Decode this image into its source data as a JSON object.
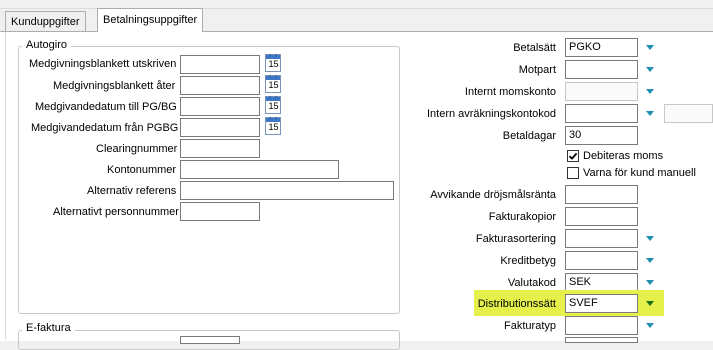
{
  "tabs": [
    {
      "label": "Kunduppgifter",
      "active": false
    },
    {
      "label": "Betalningsuppgifter",
      "active": true
    }
  ],
  "autogiro": {
    "legend": "Autogiro",
    "rows": [
      {
        "label": "Medgivningsblankett utskriven",
        "value": "",
        "calendar": true
      },
      {
        "label": "Medgivningsblankett åter",
        "value": "",
        "calendar": true
      },
      {
        "label": "Medgivandedatum till PG/BG",
        "value": "",
        "calendar": true
      },
      {
        "label": "Medgivandedatum från PGBG",
        "value": "",
        "calendar": true
      },
      {
        "label": "Clearingnummer",
        "value": ""
      },
      {
        "label": "Kontonummer",
        "value": ""
      },
      {
        "label": "Alternativ referens",
        "value": ""
      },
      {
        "label": "Alternativt personnummer",
        "value": ""
      }
    ],
    "calendar_day": "15"
  },
  "efaktura": {
    "legend": "E-faktura"
  },
  "payment": {
    "betalsatt": {
      "label": "Betalsätt",
      "value": "PGKO"
    },
    "motpart": {
      "label": "Motpart",
      "value": ""
    },
    "internt_momskonto": {
      "label": "Internt momskonto",
      "value": ""
    },
    "intern_avrakningskontokod": {
      "label": "Intern avräkningskontokod",
      "value": ""
    },
    "betaldagar": {
      "label": "Betaldagar",
      "value": "30"
    },
    "debiteras_moms": {
      "label": "Debiteras moms",
      "checked": true
    },
    "varna": {
      "label": "Varna för kund manuell",
      "checked": false
    },
    "drojsmalsranta": {
      "label": "Avvikande dröjsmålsränta",
      "value": ""
    },
    "fakturakopior": {
      "label": "Fakturakopior",
      "value": ""
    },
    "fakturasortering": {
      "label": "Fakturasortering",
      "value": ""
    },
    "kreditbetyg": {
      "label": "Kreditbetyg",
      "value": ""
    },
    "valutakod": {
      "label": "Valutakod",
      "value": "SEK"
    },
    "distributionssatt": {
      "label": "Distributionssätt",
      "value": "SVEF"
    },
    "fakturatyp": {
      "label": "Fakturatyp",
      "value": ""
    }
  },
  "colors": {
    "highlight": "#e6f04b",
    "dropdown_arrow": "#1e8fb0",
    "calendar_header": "#3d78c8"
  },
  "icons": {
    "dropdown": "chevron-down-icon",
    "calendar": "calendar-icon",
    "check": "checkmark-icon"
  }
}
